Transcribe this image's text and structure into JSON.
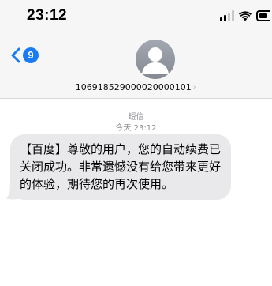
{
  "status_bar": {
    "time": "23:12",
    "icons": [
      "cellular-signal-icon",
      "wifi-icon",
      "battery-icon"
    ]
  },
  "nav": {
    "back_icon": "chevron-left-icon",
    "unread_count": "9"
  },
  "contact": {
    "avatar_icon": "person-icon",
    "number": "106918529000020000101",
    "chevron_icon": "chevron-right-icon"
  },
  "thread": {
    "message_type": "短信",
    "timestamp": "今天 23:12"
  },
  "message": {
    "text": "【百度】尊敬的用户，您的自动续费已关闭成功。非常遗憾没有给您带来更好的体验，期待您的再次使用。"
  },
  "colors": {
    "accent": "#1a7cf5",
    "bubble": "#e9e9eb",
    "meta_text": "#8e8e93"
  }
}
